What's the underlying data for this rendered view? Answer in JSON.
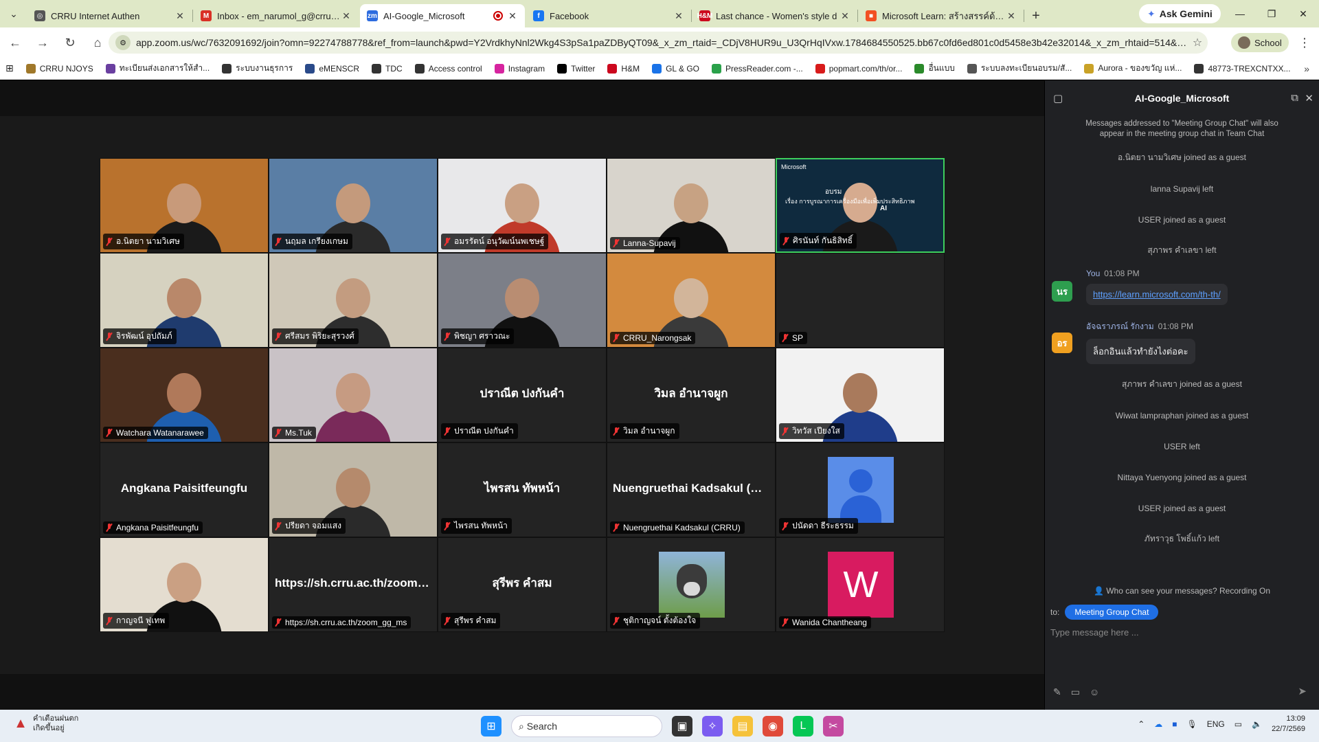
{
  "browser": {
    "tabs": [
      {
        "title": "CRRU Internet Authen",
        "favicon_color": "#555555",
        "favicon_glyph": "◎"
      },
      {
        "title": "Inbox - em_narumol_g@crru.ac",
        "favicon_color": "#d93025",
        "favicon_glyph": "M"
      },
      {
        "title": "AI-Google_Microsoft",
        "favicon_color": "#2d6cdf",
        "favicon_glyph": "zm"
      },
      {
        "title": "Facebook",
        "favicon_color": "#1877f2",
        "favicon_glyph": "f"
      },
      {
        "title": "Last chance - Women's style d",
        "favicon_color": "#cc071e",
        "favicon_glyph": "H&M"
      },
      {
        "title": "Microsoft Learn: สร้างสรรค์ด้วยท",
        "favicon_color": "#f25022",
        "favicon_glyph": "■"
      }
    ],
    "new_tab": "+",
    "gemini_label": "Ask Gemini",
    "url": "app.zoom.us/wc/7632091692/join?omn=92274788778&ref_from=launch&pwd=Y2VrdkhyNnl2Wkg4S3pSa1paZDByQT09&_x_zm_rtaid=_CDjV8HUR9u_U3QrHqIVxw.1784684550525.bb67c0fd6ed801c0d5458e3b42e32014&_x_zm_rhtaid=514&fromP...",
    "profile_label": "School",
    "bookmarks": [
      {
        "label": "CRRU NJOYS",
        "color": "#a0782a"
      },
      {
        "label": "ทะเบียนส่งเอกสารให้สำ...",
        "color": "#6a3fa0"
      },
      {
        "label": "ระบบงานธุรการ",
        "color": "#333333"
      },
      {
        "label": "eMENSCR",
        "color": "#2a4a8a"
      },
      {
        "label": "TDC",
        "color": "#333333"
      },
      {
        "label": "Access control",
        "color": "#333333"
      },
      {
        "label": "Instagram",
        "color": "#d6249f"
      },
      {
        "label": "Twitter",
        "color": "#000000"
      },
      {
        "label": "H&M",
        "color": "#cc071e"
      },
      {
        "label": "GL & GO",
        "color": "#1a73e8"
      },
      {
        "label": "PressReader.com -...",
        "color": "#2aa14a"
      },
      {
        "label": "popmart.com/th/or...",
        "color": "#d81b1b"
      },
      {
        "label": "อื่นแบบ",
        "color": "#2a8a2a"
      },
      {
        "label": "ระบบลงทะเบียนอบรม/สั...",
        "color": "#555555"
      },
      {
        "label": "Aurora - ของขวัญ แห่...",
        "color": "#c9a227"
      },
      {
        "label": "48773-TREXCNTXX...",
        "color": "#333333"
      }
    ]
  },
  "zoom": {
    "tiles": [
      {
        "name": "อ.นิตยา นามวิเศษ",
        "kind": "photo",
        "bg": "#b9722d",
        "skin": "#c89a7a",
        "shirt": "#1a1a1a"
      },
      {
        "name": "นฤมล เกรียงเกษม",
        "kind": "photo",
        "bg": "#5a7ea5",
        "skin": "#c49a7c",
        "shirt": "#2a2a2a"
      },
      {
        "name": "อมรรัตน์ อนุวัฒน์นพเชษฐ์",
        "kind": "photo",
        "bg": "#e8e8ea",
        "skin": "#c9a083",
        "shirt": "#c03a2a"
      },
      {
        "name": "Lanna-Supavij",
        "kind": "photo",
        "bg": "#d8d4cc",
        "skin": "#c7a283",
        "shirt": "#111111"
      },
      {
        "name": "ศิรนันท์ กันธิสิทธิ์",
        "kind": "photo",
        "bg": "#0f2a3e",
        "skin": "#d6ab8f",
        "shirt": "#1a1a1a",
        "speaking": true,
        "overlay_text": "อบรม",
        "overlay_text2": "เรื่อง การบูรณาการเครื่องมือเพื่อเพิ่มประสิทธิภาพ",
        "overlay_brand": "Microsoft",
        "overlay_ai": "AI"
      },
      {
        "name": "จิรพัฒน์ อุปถัมภ์",
        "kind": "photo",
        "bg": "#d6d2c0",
        "skin": "#b9886a",
        "shirt": "#1f3b6e"
      },
      {
        "name": "ศรีสมร พิริยะสุรวงศ์",
        "kind": "photo",
        "bg": "#cfc8b8",
        "skin": "#c39c80",
        "shirt": "#2d2d2d"
      },
      {
        "name": "พิชญา ศราวณะ",
        "kind": "photo",
        "bg": "#7c7f88",
        "skin": "#b98d72",
        "shirt": "#111111"
      },
      {
        "name": "CRRU_Narongsak",
        "kind": "photo",
        "bg": "#d38a3e",
        "skin": "#d2b59a",
        "shirt": "#3a3a3a"
      },
      {
        "name": "SP",
        "kind": "blank"
      },
      {
        "name": "Watchara Watanarawee",
        "kind": "photo",
        "bg": "#4a2e1e",
        "skin": "#b0795a",
        "shirt": "#1e5fb0"
      },
      {
        "name": "Ms.Tuk",
        "kind": "photo",
        "bg": "#c9c2c6",
        "skin": "#c69b82",
        "shirt": "#7a2a5a"
      },
      {
        "name": "ปราณีต ปงกันคำ",
        "kind": "text",
        "display": "ปราณีต ปงกันคำ"
      },
      {
        "name": "วิมล อำนาจผูก",
        "kind": "text",
        "display": "วิมล อำนาจผูก"
      },
      {
        "name": "วิทวัส เปียงใส",
        "kind": "photo",
        "bg": "#f2f2f2",
        "skin": "#a97a5c",
        "shirt": "#1f3d8a"
      },
      {
        "name": "Angkana Paisitfeungfu",
        "kind": "text",
        "display": "Angkana Paisitfeungfu"
      },
      {
        "name": "ปรียดา จอมแสง",
        "kind": "photo",
        "bg": "#bfb8a8",
        "skin": "#b58a6c",
        "shirt": "#2a2a2a"
      },
      {
        "name": "ไพรสน ทัพหน้า",
        "kind": "text",
        "display": "ไพรสน ทัพหน้า"
      },
      {
        "name": "Nuengruethai Kadsakul (CRRU)",
        "kind": "text",
        "display": "Nuengruethai Kadsakul (CR..."
      },
      {
        "name": "ปนัดดา ธีระธรรม",
        "kind": "avatar-blue"
      },
      {
        "name": "กาญจนี ฟูเทพ",
        "kind": "photo",
        "bg": "#e4ddd0",
        "skin": "#caa083",
        "shirt": "#111111"
      },
      {
        "name": "https://sh.crru.ac.th/zoom_gg_ms",
        "kind": "text",
        "display": "https://sh.crru.ac.th/zoom_..."
      },
      {
        "name": "สุรีพร คำสม",
        "kind": "text",
        "display": "สุรีพร คำสม"
      },
      {
        "name": "ชุติกาญจน์ ตั้งต้องใจ",
        "kind": "avatar-dog"
      },
      {
        "name": "Wanida Chantheang",
        "kind": "avatar-w",
        "letter": "W"
      }
    ]
  },
  "chat": {
    "title": "AI-Google_Microsoft",
    "notice": "Messages addressed to \"Meeting Group Chat\" will also appear in the meeting group chat in Team Chat",
    "events_top": [
      "อ.นิตยา นามวิเศษ joined as a guest",
      "lanna Supavij left",
      "USER joined as a guest",
      "สุภาพร คำเลขา left"
    ],
    "messages": [
      {
        "sender": "You",
        "time": "01:08 PM",
        "avatar_text": "นร",
        "avatar_color": "#2e9e4f",
        "text": "https://learn.microsoft.com/th-th/",
        "is_link": true
      },
      {
        "sender": "อัจฉราภรณ์ รักงาม",
        "time": "01:08 PM",
        "avatar_text": "อร",
        "avatar_color": "#f0a020",
        "text": "ล็อกอินแล้วทำยังไงต่อคะ",
        "is_link": false
      }
    ],
    "events_bottom": [
      "สุภาพร คำเลขา joined as a guest",
      "Wiwat lampraphan joined as a guest",
      "USER left",
      "Nittaya Yuenyong joined as a guest",
      "USER joined as a guest",
      "ภัทราวุธ โพธิ์แก้ว left"
    ],
    "who_can_see": "Who can see your messages? Recording On",
    "to_label": "to:",
    "to_chip": "Meeting Group Chat",
    "input_placeholder": "Type message here ..."
  },
  "taskbar": {
    "weather_line1": "คำเตือนฝนตก",
    "weather_line2": "เกิดขึ้นอยู่",
    "search_label": "Search",
    "lang": "ENG",
    "time": "13:09",
    "date": "22/7/2569"
  }
}
